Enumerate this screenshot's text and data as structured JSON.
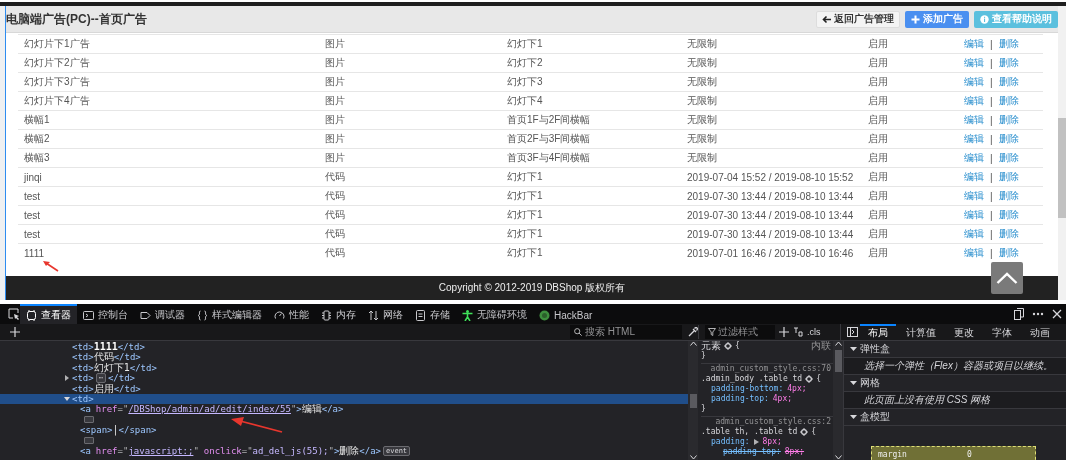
{
  "header": {
    "title": "电脑端广告(PC)--首页广告",
    "buttons": [
      {
        "kind": "back",
        "label": "返回广告管理"
      },
      {
        "kind": "add",
        "label": "添加广告"
      },
      {
        "kind": "help",
        "label": "查看帮助说明"
      }
    ]
  },
  "table": {
    "rows": [
      {
        "cells": [
          "幻灯片下1广告",
          "图片",
          "幻灯下1",
          "无限制",
          "启用"
        ],
        "edit": "编辑",
        "separator": "|",
        "delete": "删除"
      },
      {
        "cells": [
          "幻灯片下2广告",
          "图片",
          "幻灯下2",
          "无限制",
          "启用"
        ],
        "edit": "编辑",
        "separator": "|",
        "delete": "删除"
      },
      {
        "cells": [
          "幻灯片下3广告",
          "图片",
          "幻灯下3",
          "无限制",
          "启用"
        ],
        "edit": "编辑",
        "separator": "|",
        "delete": "删除"
      },
      {
        "cells": [
          "幻灯片下4广告",
          "图片",
          "幻灯下4",
          "无限制",
          "启用"
        ],
        "edit": "编辑",
        "separator": "|",
        "delete": "删除"
      },
      {
        "cells": [
          "横幅1",
          "图片",
          "首页1F与2F间横幅",
          "无限制",
          "启用"
        ],
        "edit": "编辑",
        "separator": "|",
        "delete": "删除"
      },
      {
        "cells": [
          "横幅2",
          "图片",
          "首页2F与3F间横幅",
          "无限制",
          "启用"
        ],
        "edit": "编辑",
        "separator": "|",
        "delete": "删除"
      },
      {
        "cells": [
          "横幅3",
          "图片",
          "首页3F与4F间横幅",
          "无限制",
          "启用"
        ],
        "edit": "编辑",
        "separator": "|",
        "delete": "删除"
      },
      {
        "cells": [
          "jinqi",
          "代码",
          "幻灯下1",
          "2019-07-04 15:52 / 2019-08-10 15:52",
          "启用"
        ],
        "edit": "编辑",
        "separator": "|",
        "delete": "删除"
      },
      {
        "cells": [
          "test",
          "代码",
          "幻灯下1",
          "2019-07-30 13:44 / 2019-08-10 13:44",
          "启用"
        ],
        "edit": "编辑",
        "separator": "|",
        "delete": "删除"
      },
      {
        "cells": [
          "test",
          "代码",
          "幻灯下1",
          "2019-07-30 13:44 / 2019-08-10 13:44",
          "启用"
        ],
        "edit": "编辑",
        "separator": "|",
        "delete": "删除"
      },
      {
        "cells": [
          "test",
          "代码",
          "幻灯下1",
          "2019-07-30 13:44 / 2019-08-10 13:44",
          "启用"
        ],
        "edit": "编辑",
        "separator": "|",
        "delete": "删除"
      },
      {
        "cells": [
          "1111",
          "代码",
          "幻灯下1",
          "2019-07-01 16:46 / 2019-08-10 16:46",
          "启用"
        ],
        "edit": "编辑",
        "separator": "|",
        "delete": "删除"
      }
    ]
  },
  "footer": {
    "copyright": "Copyright © 2012-2019 DBShop 版权所有"
  },
  "devtools": {
    "tabs": [
      {
        "kind": "inspector",
        "label": "查看器",
        "selected": true
      },
      {
        "kind": "console",
        "label": "控制台",
        "selected": false
      },
      {
        "kind": "debugger",
        "label": "调试器",
        "selected": false
      },
      {
        "kind": "style",
        "label": "样式编辑器",
        "selected": false
      },
      {
        "kind": "performance",
        "label": "性能",
        "selected": false
      },
      {
        "kind": "memory",
        "label": "内存",
        "selected": false
      },
      {
        "kind": "network",
        "label": "网络",
        "selected": false
      },
      {
        "kind": "storage",
        "label": "存储",
        "selected": false
      },
      {
        "kind": "accessibility",
        "label": "无障碍环境",
        "selected": false
      },
      {
        "kind": "hackbar",
        "label": "HackBar",
        "selected": false
      }
    ],
    "search": {
      "placeholder": "搜索 HTML"
    },
    "markup": [
      {
        "selected": false,
        "parts": [
          {
            "kind": "tag",
            "text": "<td>"
          },
          {
            "kind": "strong",
            "text": "1111"
          },
          {
            "kind": "tag",
            "text": "</td>"
          }
        ]
      },
      {
        "selected": false,
        "parts": [
          {
            "kind": "tag",
            "text": "<td>"
          },
          {
            "kind": "text",
            "text": "代码"
          },
          {
            "kind": "tag",
            "text": "</td>"
          }
        ]
      },
      {
        "selected": false,
        "parts": [
          {
            "kind": "tag",
            "text": "<td>"
          },
          {
            "kind": "text",
            "text": "幻灯下1"
          },
          {
            "kind": "tag",
            "text": "</td>"
          }
        ]
      },
      {
        "selected": false,
        "expanded": false,
        "parts": [
          {
            "kind": "tag",
            "text": "<td>"
          },
          {
            "kind": "badge",
            "text": "⋯"
          },
          {
            "kind": "tag",
            "text": "</td>"
          }
        ]
      },
      {
        "selected": false,
        "parts": [
          {
            "kind": "tag",
            "text": "<td>"
          },
          {
            "kind": "text",
            "text": "启用"
          },
          {
            "kind": "tag",
            "text": "</td>"
          }
        ]
      },
      {
        "selected": true,
        "expanded": true,
        "parts": [
          {
            "kind": "tag",
            "text": "<td>"
          }
        ],
        "children": [
          {
            "selected": false,
            "parts": [
              {
                "kind": "tag",
                "text": "<a"
              },
              {
                "kind": "attr",
                "text": "href"
              },
              {
                "kind": "punct",
                "text": "=\""
              },
              {
                "kind": "link",
                "text": "/DBShop/admin/ad/edit/index/55"
              },
              {
                "kind": "punct",
                "text": "\""
              },
              {
                "kind": "tag",
                "text": ">"
              },
              {
                "kind": "text",
                "text": "编辑"
              },
              {
                "kind": "tag",
                "text": "</a>"
              }
            ]
          },
          {
            "selected": false,
            "parts": [
              {
                "kind": "whitespace"
              }
            ]
          },
          {
            "selected": false,
            "parts": [
              {
                "kind": "tag",
                "text": "<span>"
              },
              {
                "kind": "text",
                "text": "|"
              },
              {
                "kind": "tag",
                "text": "</span>"
              }
            ]
          },
          {
            "selected": false,
            "parts": [
              {
                "kind": "whitespace"
              }
            ]
          },
          {
            "selected": false,
            "parts": [
              {
                "kind": "tag",
                "text": "<a"
              },
              {
                "kind": "attr",
                "text": "href"
              },
              {
                "kind": "punct",
                "text": "=\""
              },
              {
                "kind": "link",
                "text": "javascript:;"
              },
              {
                "kind": "punct",
                "text": "\""
              },
              {
                "kind": "attr",
                "text": "onclick"
              },
              {
                "kind": "punct",
                "text": "=\""
              },
              {
                "kind": "value",
                "text": "ad_del_js(55);"
              },
              {
                "kind": "punct",
                "text": "\""
              },
              {
                "kind": "tag",
                "text": ">"
              },
              {
                "kind": "text",
                "text": "删除"
              },
              {
                "kind": "tag",
                "text": "</a>"
              },
              {
                "kind": "badge",
                "text": "event"
              }
            ]
          }
        ]
      }
    ],
    "rules_filter": {
      "placeholder": "过滤样式"
    },
    "cls": ".cls",
    "rules": [
      {
        "kind": "selector",
        "text": "元素",
        "brace": "{",
        "origin": "内联"
      },
      {
        "kind": "close",
        "text": "}"
      },
      {
        "kind": "source",
        "text": "admin_custom_style.css:70"
      },
      {
        "kind": "selector",
        "text": ".admin_body .table td",
        "brace": "{"
      },
      {
        "kind": "prop",
        "name": "padding-bottom:",
        "value": "4px;",
        "overridden": false
      },
      {
        "kind": "prop",
        "name": "padding-top:",
        "value": "4px;",
        "overridden": false
      },
      {
        "kind": "close",
        "text": "}"
      },
      {
        "kind": "source",
        "text": "admin_custom_style.css:2"
      },
      {
        "kind": "selector",
        "text": ".table th, .table td",
        "brace": "{"
      },
      {
        "kind": "prop",
        "name": "padding:",
        "value": "8px;",
        "overridden": false,
        "expandable": true
      },
      {
        "kind": "prop",
        "name": "padding-top:",
        "value": "8px;",
        "overridden": true
      }
    ],
    "sidebar_tabs": [
      {
        "label": "布局",
        "selected": true
      },
      {
        "label": "计算值",
        "selected": false
      },
      {
        "label": "更改",
        "selected": false
      },
      {
        "label": "字体",
        "selected": false
      },
      {
        "label": "动画",
        "selected": false
      }
    ],
    "sections": [
      {
        "title": "弹性盒",
        "expanded": true,
        "note": "选择一个弹性（Flex）容器或项目以继续。"
      },
      {
        "title": "网格",
        "expanded": true,
        "note": "此页面上没有使用 CSS 网格"
      },
      {
        "title": "盒模型",
        "expanded": true,
        "box_model": {
          "label": "margin",
          "value": "0"
        }
      }
    ]
  }
}
